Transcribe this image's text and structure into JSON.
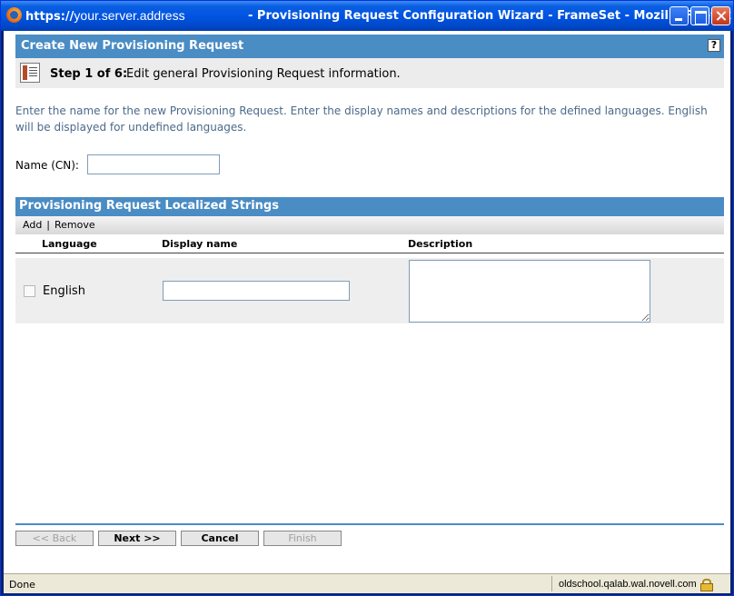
{
  "window": {
    "url_prefix": "https://",
    "url_host": "your.server.address",
    "title": "- Provisioning Request Configuration Wizard - FrameSet - Mozilla Firefox"
  },
  "header": {
    "title": "Create New Provisioning Request",
    "help_label": "?"
  },
  "step": {
    "label": "Step 1 of 6:",
    "description": "Edit general Provisioning Request information."
  },
  "intro": "Enter the name for the new Provisioning Request.  Enter the display names and descriptions for the defined languages.  English will be displayed for undefined languages.",
  "name_field": {
    "label": "Name (CN):",
    "value": ""
  },
  "localized": {
    "title": "Provisioning Request Localized Strings",
    "add_label": "Add",
    "separator": "|",
    "remove_label": "Remove",
    "columns": [
      "Language",
      "Display name",
      "Description"
    ],
    "rows": [
      {
        "language": "English",
        "display_name": "",
        "description": "",
        "checked": false
      }
    ]
  },
  "buttons": {
    "back": "<< Back",
    "next": "Next >>",
    "cancel": "Cancel",
    "finish": "Finish"
  },
  "statusbar": {
    "status": "Done",
    "host": "oldschool.qalab.wal.novell.com"
  },
  "colors": {
    "header_blue": "#4a8cc4",
    "intro_text": "#4a6a8a"
  },
  "icons": [
    "firefox-icon",
    "minimize-icon",
    "maximize-icon",
    "close-icon",
    "help-icon",
    "step-icon",
    "lock-icon"
  ]
}
